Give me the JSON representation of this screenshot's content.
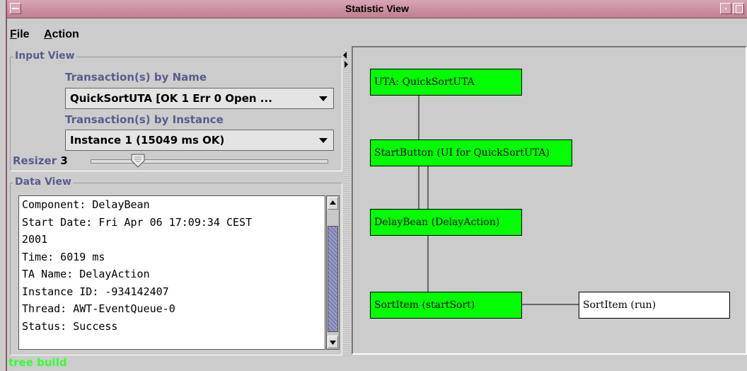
{
  "window": {
    "title": "Statistic View"
  },
  "menu": {
    "file": "File",
    "action": "Action"
  },
  "input_view": {
    "title": "Input View",
    "by_name_label": "Transaction(s) by Name",
    "by_name_value": "QuickSortUTA [OK 1 Err 0 Open ...",
    "by_instance_label": "Transaction(s) by Instance",
    "by_instance_value": "Instance 1 (15049 ms OK)",
    "resizer_label": "Resizer",
    "resizer_value": "3"
  },
  "data_view": {
    "title": "Data View",
    "lines": [
      "Component: DelayBean",
      "Start Date: Fri Apr 06 17:09:34 CEST",
      "2001",
      "Time: 6019 ms",
      "TA Name: DelayAction",
      "Instance ID: -934142407",
      "Thread: AWT-EventQueue-0",
      "Status: Success"
    ]
  },
  "graph": {
    "nodes": [
      {
        "label": "UTA: QuickSortUTA",
        "color": "#00ff00"
      },
      {
        "label": "StartButton (UI for QuickSortUTA)",
        "color": "#00ff00"
      },
      {
        "label": "DelayBean (DelayAction)",
        "color": "#00ff00"
      },
      {
        "label": "SortItem (startSort)",
        "color": "#00ff00"
      },
      {
        "label": "SortItem (run)",
        "color": "#ffffff"
      }
    ]
  },
  "status": {
    "text": "tree build",
    "color": "#33ff33"
  }
}
